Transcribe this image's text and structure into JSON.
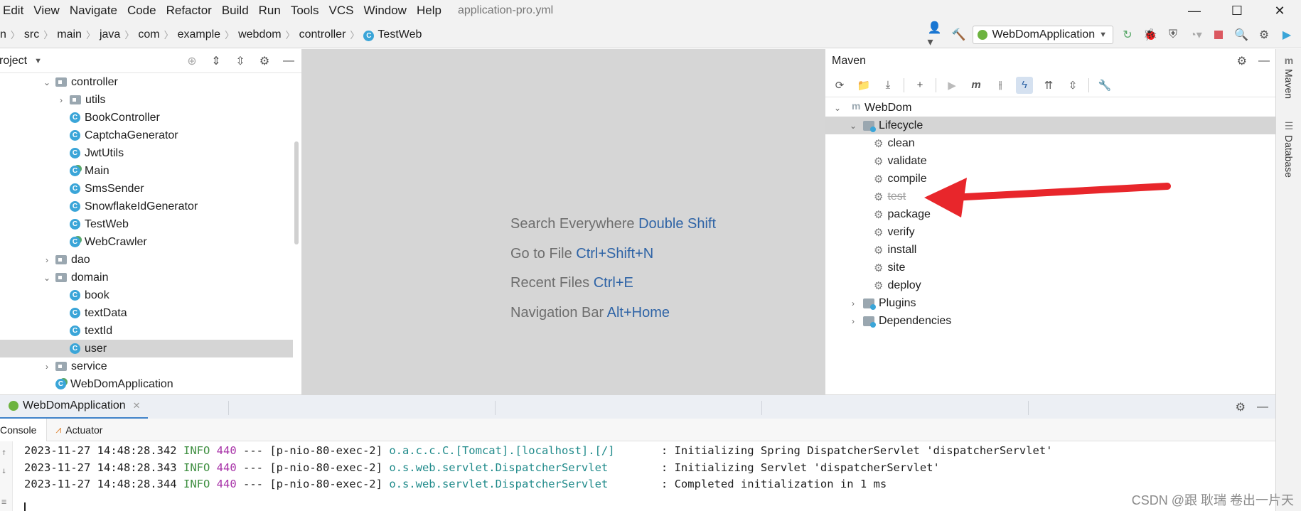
{
  "menu": {
    "items": [
      "Edit",
      "View",
      "Navigate",
      "Code",
      "Refactor",
      "Build",
      "Run",
      "Tools",
      "VCS",
      "Window",
      "Help"
    ],
    "window_title": "application-pro.yml"
  },
  "window_controls": {
    "minimize": "—",
    "maximize": "☐",
    "close": "✕"
  },
  "breadcrumb": {
    "first_partial": "n",
    "items": [
      "src",
      "main",
      "java",
      "com",
      "example",
      "webdom",
      "controller"
    ],
    "current": "TestWeb"
  },
  "toolbar": {
    "run_config": "WebDomApplication",
    "icons": [
      "user-icon",
      "hammer-icon",
      "spring-icon",
      "rerun-icon",
      "debug-icon",
      "coverage-icon",
      "profile-icon",
      "stop-icon",
      "search-icon",
      "settings-icon",
      "plugin-icon"
    ]
  },
  "project": {
    "title": "roject",
    "tree": [
      {
        "label": "controller",
        "type": "folder",
        "depth": 1,
        "expanded": true
      },
      {
        "label": "utils",
        "type": "folder",
        "depth": 2,
        "expanded": false
      },
      {
        "label": "BookController",
        "type": "class",
        "depth": 2
      },
      {
        "label": "CaptchaGenerator",
        "type": "class",
        "depth": 2
      },
      {
        "label": "JwtUtils",
        "type": "class",
        "depth": 2
      },
      {
        "label": "Main",
        "type": "runclass",
        "depth": 2
      },
      {
        "label": "SmsSender",
        "type": "class",
        "depth": 2
      },
      {
        "label": "SnowflakeIdGenerator",
        "type": "class",
        "depth": 2
      },
      {
        "label": "TestWeb",
        "type": "class",
        "depth": 2
      },
      {
        "label": "WebCrawler",
        "type": "runclass",
        "depth": 2
      },
      {
        "label": "dao",
        "type": "folder",
        "depth": 1,
        "expanded": false
      },
      {
        "label": "domain",
        "type": "folder",
        "depth": 1,
        "expanded": true
      },
      {
        "label": "book",
        "type": "class",
        "depth": 2
      },
      {
        "label": "textData",
        "type": "class",
        "depth": 2
      },
      {
        "label": "textId",
        "type": "class",
        "depth": 2
      },
      {
        "label": "user",
        "type": "class",
        "depth": 2,
        "selected": true
      },
      {
        "label": "service",
        "type": "folder",
        "depth": 1,
        "expanded": false
      },
      {
        "label": "WebDomApplication",
        "type": "springclass",
        "depth": 1
      }
    ]
  },
  "editor": {
    "hints": [
      {
        "text": "Search Everywhere",
        "key": "Double Shift"
      },
      {
        "text": "Go to File",
        "key": "Ctrl+Shift+N"
      },
      {
        "text": "Recent Files",
        "key": "Ctrl+E"
      },
      {
        "text": "Navigation Bar",
        "key": "Alt+Home"
      }
    ]
  },
  "maven": {
    "title": "Maven",
    "root": "WebDom",
    "lifecycle_label": "Lifecycle",
    "goals": [
      {
        "name": "clean",
        "disabled": false
      },
      {
        "name": "validate",
        "disabled": false
      },
      {
        "name": "compile",
        "disabled": false
      },
      {
        "name": "test",
        "disabled": true
      },
      {
        "name": "package",
        "disabled": false
      },
      {
        "name": "verify",
        "disabled": false
      },
      {
        "name": "install",
        "disabled": false
      },
      {
        "name": "site",
        "disabled": false
      },
      {
        "name": "deploy",
        "disabled": false
      }
    ],
    "plugins_label": "Plugins",
    "dependencies_label": "Dependencies"
  },
  "right_strip": {
    "maven_tab": "Maven",
    "database_tab": "Database"
  },
  "run": {
    "tab_label": "WebDomApplication",
    "console_tab": "Console",
    "actuator_tab": "Actuator",
    "log": [
      {
        "ts": "2023-11-27 14:48:28.342",
        "level": "INFO",
        "pid": "440",
        "thread": "--- [p-nio-80-exec-2]",
        "logger": "o.a.c.c.C.[Tomcat].[localhost].[/]      ",
        "msg": " : Initializing Spring DispatcherServlet 'dispatcherServlet'"
      },
      {
        "ts": "2023-11-27 14:48:28.343",
        "level": "INFO",
        "pid": "440",
        "thread": "--- [p-nio-80-exec-2]",
        "logger": "o.s.web.servlet.DispatcherServlet       ",
        "msg": " : Initializing Servlet 'dispatcherServlet'"
      },
      {
        "ts": "2023-11-27 14:48:28.344",
        "level": "INFO",
        "pid": "440",
        "thread": "--- [p-nio-80-exec-2]",
        "logger": "o.s.web.servlet.DispatcherServlet       ",
        "msg": " : Completed initialization in 1 ms"
      }
    ]
  },
  "watermark": "CSDN @跟 耿瑞 卷出一片天",
  "colors": {
    "accent": "#2f64a6",
    "annotation_arrow": "#e8262b",
    "selection": "#d5d5d5"
  }
}
